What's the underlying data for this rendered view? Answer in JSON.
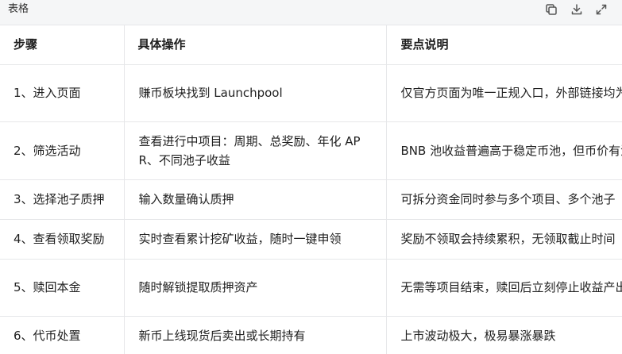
{
  "toolbar": {
    "title": "表格",
    "icons": [
      "copy-icon",
      "download-icon",
      "expand-icon"
    ]
  },
  "table": {
    "headers": [
      "步骤",
      "具体操作",
      "要点说明"
    ],
    "rows": [
      [
        "1、进入页面",
        "赚币板块找到 Launchpool",
        "仅官方页面为唯一正规入口，外部链接均为诈骗"
      ],
      [
        "2、筛选活动",
        "查看进行中项目：周期、总奖励、年化 APR、不同池子收益",
        "BNB 池收益普遍高于稳定币池，但币价有波动风险"
      ],
      [
        "3、选择池子质押",
        "输入数量确认质押",
        "可拆分资金同时参与多个项目、多个池子"
      ],
      [
        "4、查看领取奖励",
        "实时查看累计挖矿收益，随时一键申领",
        "奖励不领取会持续累积，无领取截止时间"
      ],
      [
        "5、赎回本金",
        "随时解锁提取质押资产",
        "无需等项目结束，赎回后立刻停止收益产出"
      ],
      [
        "6、代币处置",
        "新币上线现货后卖出或长期持有",
        "上市波动极大，极易暴涨暴跌"
      ]
    ]
  }
}
